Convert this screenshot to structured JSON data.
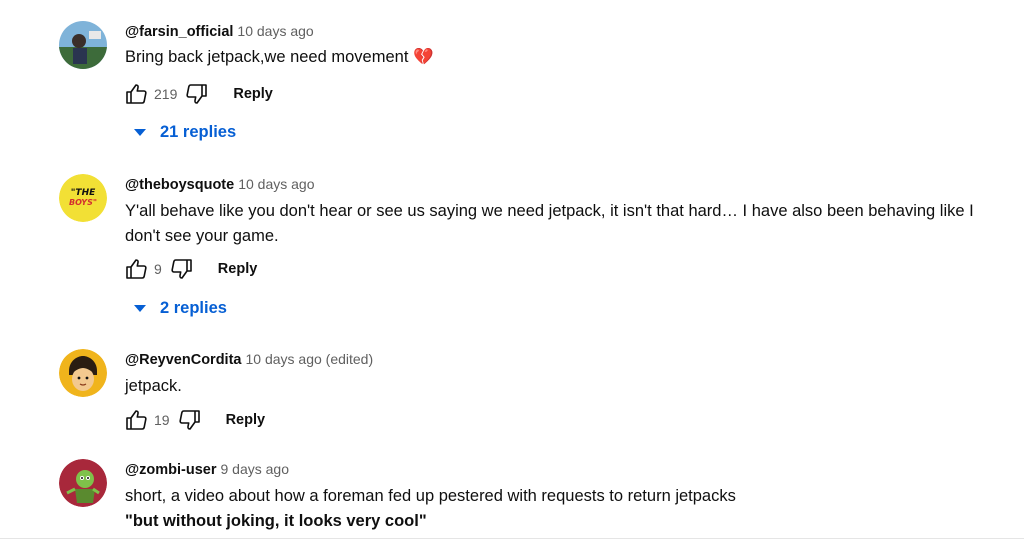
{
  "comments": [
    {
      "author": "@farsin_official",
      "time": "10 days ago",
      "text": "Bring back jetpack,we need movement",
      "emoji": "💔",
      "likes": "219",
      "reply_label": "Reply",
      "replies_label": "21 replies"
    },
    {
      "author": "@theboysquote",
      "time": "10 days ago",
      "text": "Y'all behave like you don't hear or see us saying we need jetpack, it isn't that hard… I have also been behaving like I don't see your game.",
      "likes": "9",
      "reply_label": "Reply",
      "replies_label": "2 replies",
      "avatar_text": "THE BOYS"
    },
    {
      "author": "@ReyvenCordita",
      "time": "10 days ago (edited)",
      "text": "jetpack.",
      "likes": "19",
      "reply_label": "Reply"
    },
    {
      "author": "@zombi-user",
      "time": "9 days ago",
      "text": "short, a video about how a foreman fed up  pestered with requests to return jetpacks",
      "text_bold": "\"but without joking, it looks very cool\""
    }
  ],
  "icons": [
    "like-icon",
    "dislike-icon",
    "caret-down-icon"
  ],
  "colors": {
    "link": "#065fd4",
    "secondary_text": "#606060"
  }
}
